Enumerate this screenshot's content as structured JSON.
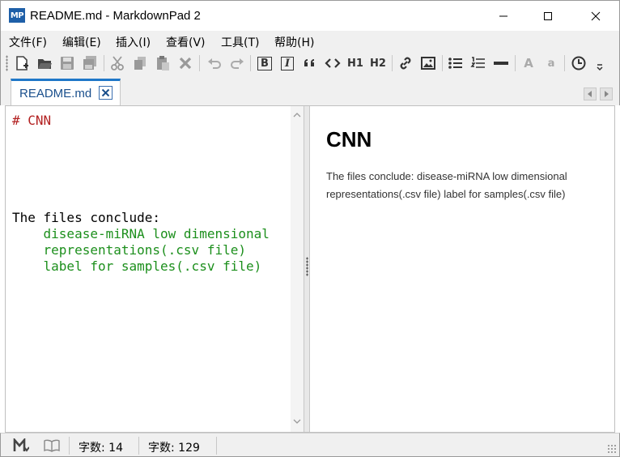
{
  "window": {
    "app_icon_text": "MP",
    "title": "README.md - MarkdownPad 2"
  },
  "menu": {
    "items": [
      "文件(F)",
      "编辑(E)",
      "插入(I)",
      "查看(V)",
      "工具(T)",
      "帮助(H)"
    ]
  },
  "toolbar": {
    "h1_label": "H1",
    "h2_label": "H2",
    "bold_label": "B",
    "italic_label": "I",
    "uppercase_label": "A",
    "lowercase_label": "a"
  },
  "tabs": [
    {
      "label": "README.md",
      "active": true
    }
  ],
  "editor": {
    "lines": [
      {
        "text": "# CNN",
        "style": "heading"
      },
      {
        "text": "The files conclude:",
        "style": "plain"
      },
      {
        "text": "    disease-miRNA low dimensional",
        "style": "green"
      },
      {
        "text": "    representations(.csv file)",
        "style": "green"
      },
      {
        "text": "    label for samples(.csv file)",
        "style": "green"
      }
    ]
  },
  "preview": {
    "heading": "CNN",
    "paragraph": "The files conclude: disease-miRNA low dimensional representations(.csv file) label for samples(.csv file)"
  },
  "status": {
    "word_count_label": "字数: 14",
    "char_count_label": "字数: 129"
  },
  "colors": {
    "accent": "#1f77c8",
    "app_icon_bg": "#1e5fa8",
    "heading_code": "#b32121",
    "list_code": "#1c8f1c"
  }
}
